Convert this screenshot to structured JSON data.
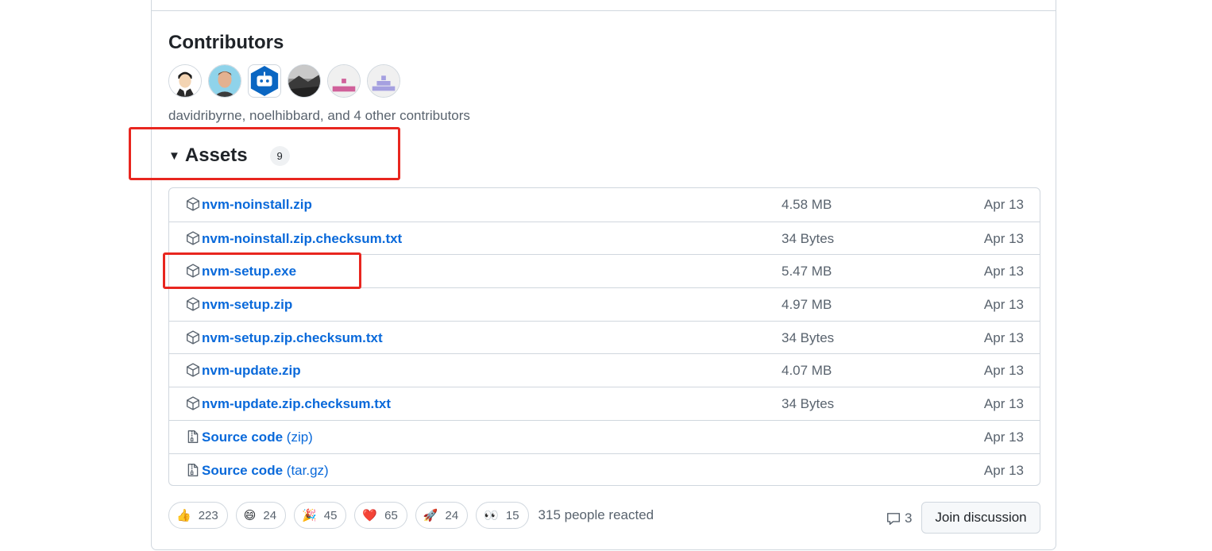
{
  "contributors": {
    "title": "Contributors",
    "summary": "davidribyrne, noelhibbard, and 4 other contributors",
    "avatars": [
      "avatar-cartoon-man",
      "avatar-man-photo",
      "avatar-bot",
      "avatar-landscape",
      "avatar-identicon-pink",
      "avatar-identicon-purple"
    ]
  },
  "assets": {
    "label": "Assets",
    "count": "9",
    "toggle_icon": "triangle-down-icon",
    "items": [
      {
        "name": "nvm-noinstall.zip",
        "suffix": "",
        "size": "4.58 MB",
        "date": "Apr 13",
        "icon": "package-icon"
      },
      {
        "name": "nvm-noinstall.zip.checksum.txt",
        "suffix": "",
        "size": "34 Bytes",
        "date": "Apr 13",
        "icon": "package-icon"
      },
      {
        "name": "nvm-setup.exe",
        "suffix": "",
        "size": "5.47 MB",
        "date": "Apr 13",
        "icon": "package-icon"
      },
      {
        "name": "nvm-setup.zip",
        "suffix": "",
        "size": "4.97 MB",
        "date": "Apr 13",
        "icon": "package-icon"
      },
      {
        "name": "nvm-setup.zip.checksum.txt",
        "suffix": "",
        "size": "34 Bytes",
        "date": "Apr 13",
        "icon": "package-icon"
      },
      {
        "name": "nvm-update.zip",
        "suffix": "",
        "size": "4.07 MB",
        "date": "Apr 13",
        "icon": "package-icon"
      },
      {
        "name": "nvm-update.zip.checksum.txt",
        "suffix": "",
        "size": "34 Bytes",
        "date": "Apr 13",
        "icon": "package-icon"
      },
      {
        "name": "Source code",
        "suffix": "(zip)",
        "size": "",
        "date": "Apr 13",
        "icon": "file-zip-icon"
      },
      {
        "name": "Source code",
        "suffix": "(tar.gz)",
        "size": "",
        "date": "Apr 13",
        "icon": "file-zip-icon"
      }
    ]
  },
  "reactions": {
    "items": [
      {
        "emoji": "👍",
        "count": "223",
        "name": "thumbs-up"
      },
      {
        "emoji": "😄",
        "count": "24",
        "name": "laugh"
      },
      {
        "emoji": "🎉",
        "count": "45",
        "name": "hooray"
      },
      {
        "emoji": "❤️",
        "count": "65",
        "name": "heart"
      },
      {
        "emoji": "🚀",
        "count": "24",
        "name": "rocket"
      },
      {
        "emoji": "👀",
        "count": "15",
        "name": "eyes"
      }
    ],
    "summary": "315 people reacted"
  },
  "discussion": {
    "comment_count": "3",
    "join_label": "Join discussion"
  },
  "colors": {
    "link": "#0969da",
    "muted": "#59636e",
    "border": "#d0d7de",
    "highlight": "#e8261f"
  }
}
